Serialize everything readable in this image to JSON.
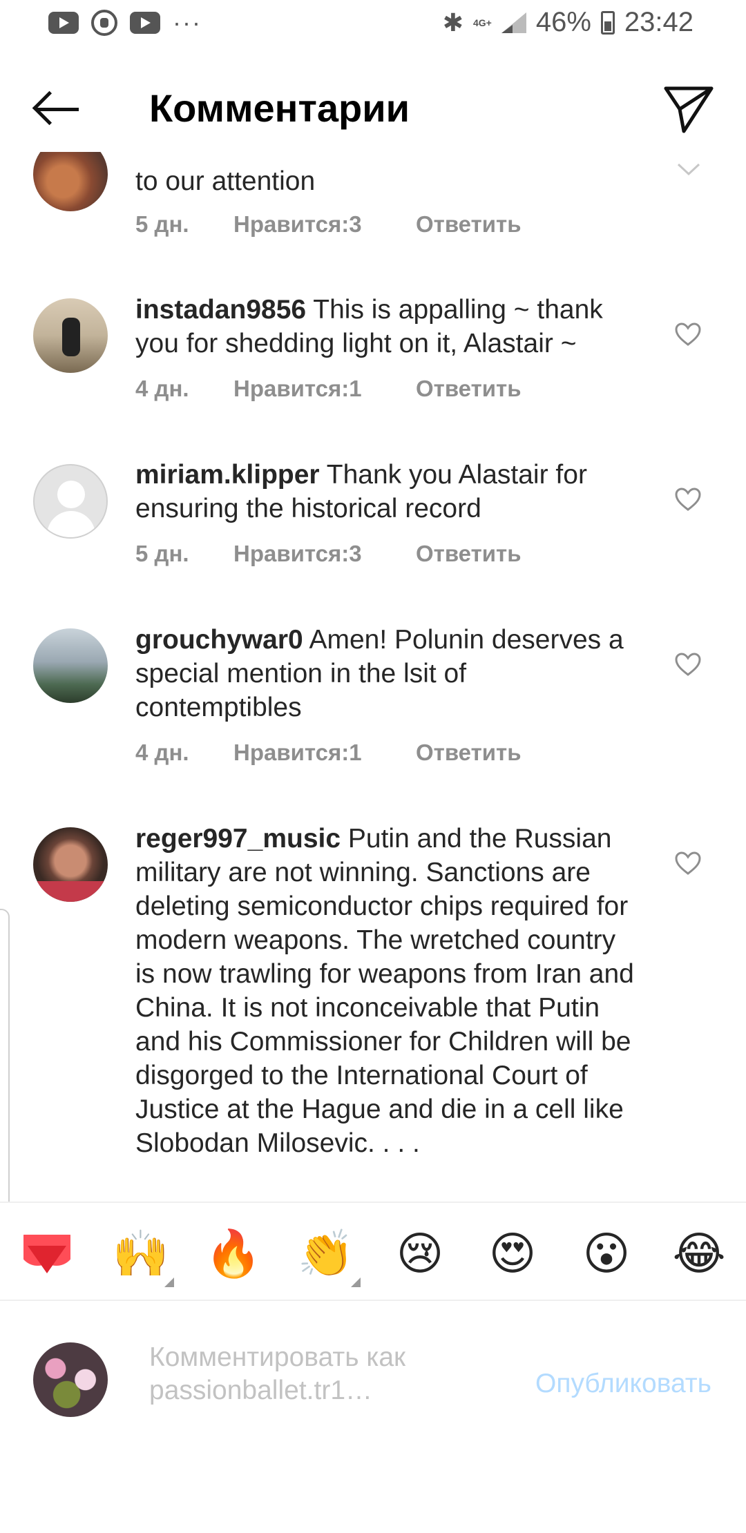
{
  "status_bar": {
    "app_icons": [
      "youtube-icon",
      "whatsapp-icon",
      "youtube-icon"
    ],
    "more": "···",
    "network": "4G+",
    "battery": "46%",
    "time": "23:42"
  },
  "header": {
    "title": "Комментарии"
  },
  "labels": {
    "likes_prefix": "Нравится: ",
    "reply": "Ответить"
  },
  "comments": [
    {
      "username": "",
      "text": "to our attention",
      "time": "5 дн.",
      "likes": "3"
    },
    {
      "username": "instadan9856",
      "text": "This is appalling ~ thank you for shedding light on it, Alastair ~",
      "time": "4 дн.",
      "likes": "1"
    },
    {
      "username": "miriam.klipper",
      "text": "Thank you Alastair for ensuring the historical record",
      "time": "5 дн.",
      "likes": "3"
    },
    {
      "username": "grouchywar0",
      "text": "Amen! Polunin deserves a special mention in the lsit of contemptibles",
      "time": "4 дн.",
      "likes": "1"
    },
    {
      "username": "reger997_music",
      "text": "Putin and the Russian military are not winning. Sanctions are deleting semiconductor chips required for modern weapons. The wretched country is now trawling for weapons from Iran and China. It is not inconceivable that Putin and his Commissioner for Children will be disgorged to the International Court of Justice at the Hague and die in a cell like Slobodan Milosevic. . . ."
    }
  ],
  "emoji_bar": [
    "❤️",
    "🙌",
    "🔥",
    "👏",
    "😢",
    "😍",
    "😮",
    "😂"
  ],
  "composer": {
    "placeholder": "Комментировать как\npassionballet.tr1…",
    "publish_label": "Опубликовать"
  }
}
